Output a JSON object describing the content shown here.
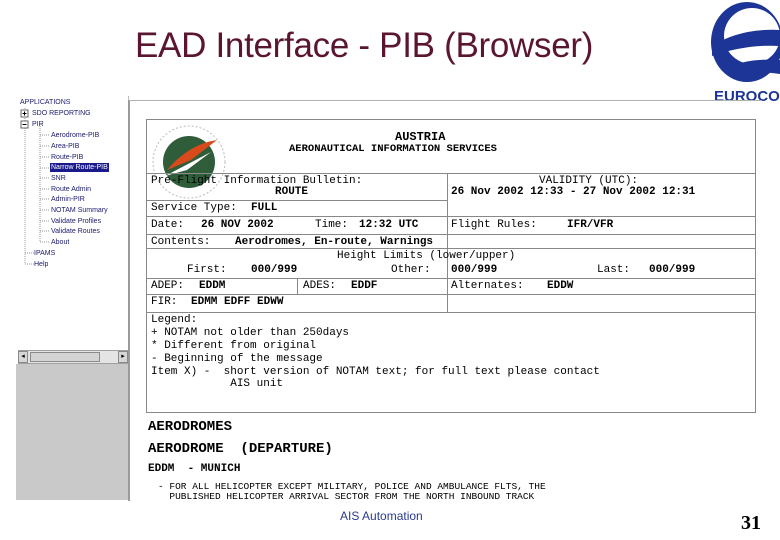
{
  "slide": {
    "title": "EAD Interface - PIB (Browser)",
    "logo_text": "EUROCONTROL",
    "footer": "AIS Automation",
    "page_number": "31"
  },
  "sidebar": {
    "items": [
      {
        "label": "APPLICATIONS"
      },
      {
        "label": "SDO REPORTING"
      },
      {
        "label": "PIR"
      },
      {
        "label": "Aerodrome-PIB"
      },
      {
        "label": "Area-PIB"
      },
      {
        "label": "Route-PIB"
      },
      {
        "label": "Narrow Route-PIB"
      },
      {
        "label": "SNR"
      },
      {
        "label": "Route Admin"
      },
      {
        "label": "Admin-PIR"
      },
      {
        "label": "NOTAM Summary"
      },
      {
        "label": "Validate Profiles"
      },
      {
        "label": "Validate Routes"
      },
      {
        "label": "About"
      },
      {
        "label": "IPAMS"
      },
      {
        "label": "Help"
      }
    ]
  },
  "pib": {
    "country": "AUSTRIA",
    "service": "AERONAUTICAL INFORMATION SERVICES",
    "bulletin_label": "Pre-Flight Information Bulletin:",
    "bulletin_type": "ROUTE",
    "validity_label": "VALIDITY (UTC):",
    "validity_value": "26 Nov 2002 12:33 - 27 Nov 2002 12:31",
    "service_type_label": "Service Type:",
    "service_type_value": "FULL",
    "date_label": "Date:",
    "date_value": "26 NOV 2002",
    "time_label": "Time:",
    "time_value": "12:32 UTC",
    "flight_rules_label": "Flight Rules:",
    "flight_rules_value": "IFR/VFR",
    "contents_label": "Contents:",
    "contents_value": "Aerodromes, En-route, Warnings",
    "height_limits": "Height Limits (lower/upper)",
    "first_label": "First:",
    "first_value": "000/999",
    "other_label": "Other:",
    "other_value": "000/999",
    "last_label": "Last:",
    "last_value": "000/999",
    "adep_label": "ADEP:",
    "adep_value": "EDDM",
    "ades_label": "ADES:",
    "ades_value": "EDDF",
    "alternates_label": "Alternates:",
    "alternates_value": "EDDW",
    "fir_label": "FIR:",
    "fir_value": "EDMM EDFF EDWW",
    "legend_title": "Legend:",
    "legend_lines": [
      "+ NOTAM not older than 250days",
      "* Different from original",
      "- Beginning of the message",
      "Item X) -  short version of NOTAM text; for full text please contact",
      "            AIS unit"
    ]
  },
  "aerodromes": {
    "heading": "AERODROMES",
    "subheading": "AERODROME  (DEPARTURE)",
    "station": "EDDM  - MUNICH",
    "notam_line1": "- FOR ALL HELICOPTER EXCEPT MILITARY, POLICE AND AMBULANCE FLTS, THE",
    "notam_line2": "  PUBLISHED HELICOPTER ARRIVAL SECTOR FROM THE NORTH INBOUND TRACK"
  }
}
